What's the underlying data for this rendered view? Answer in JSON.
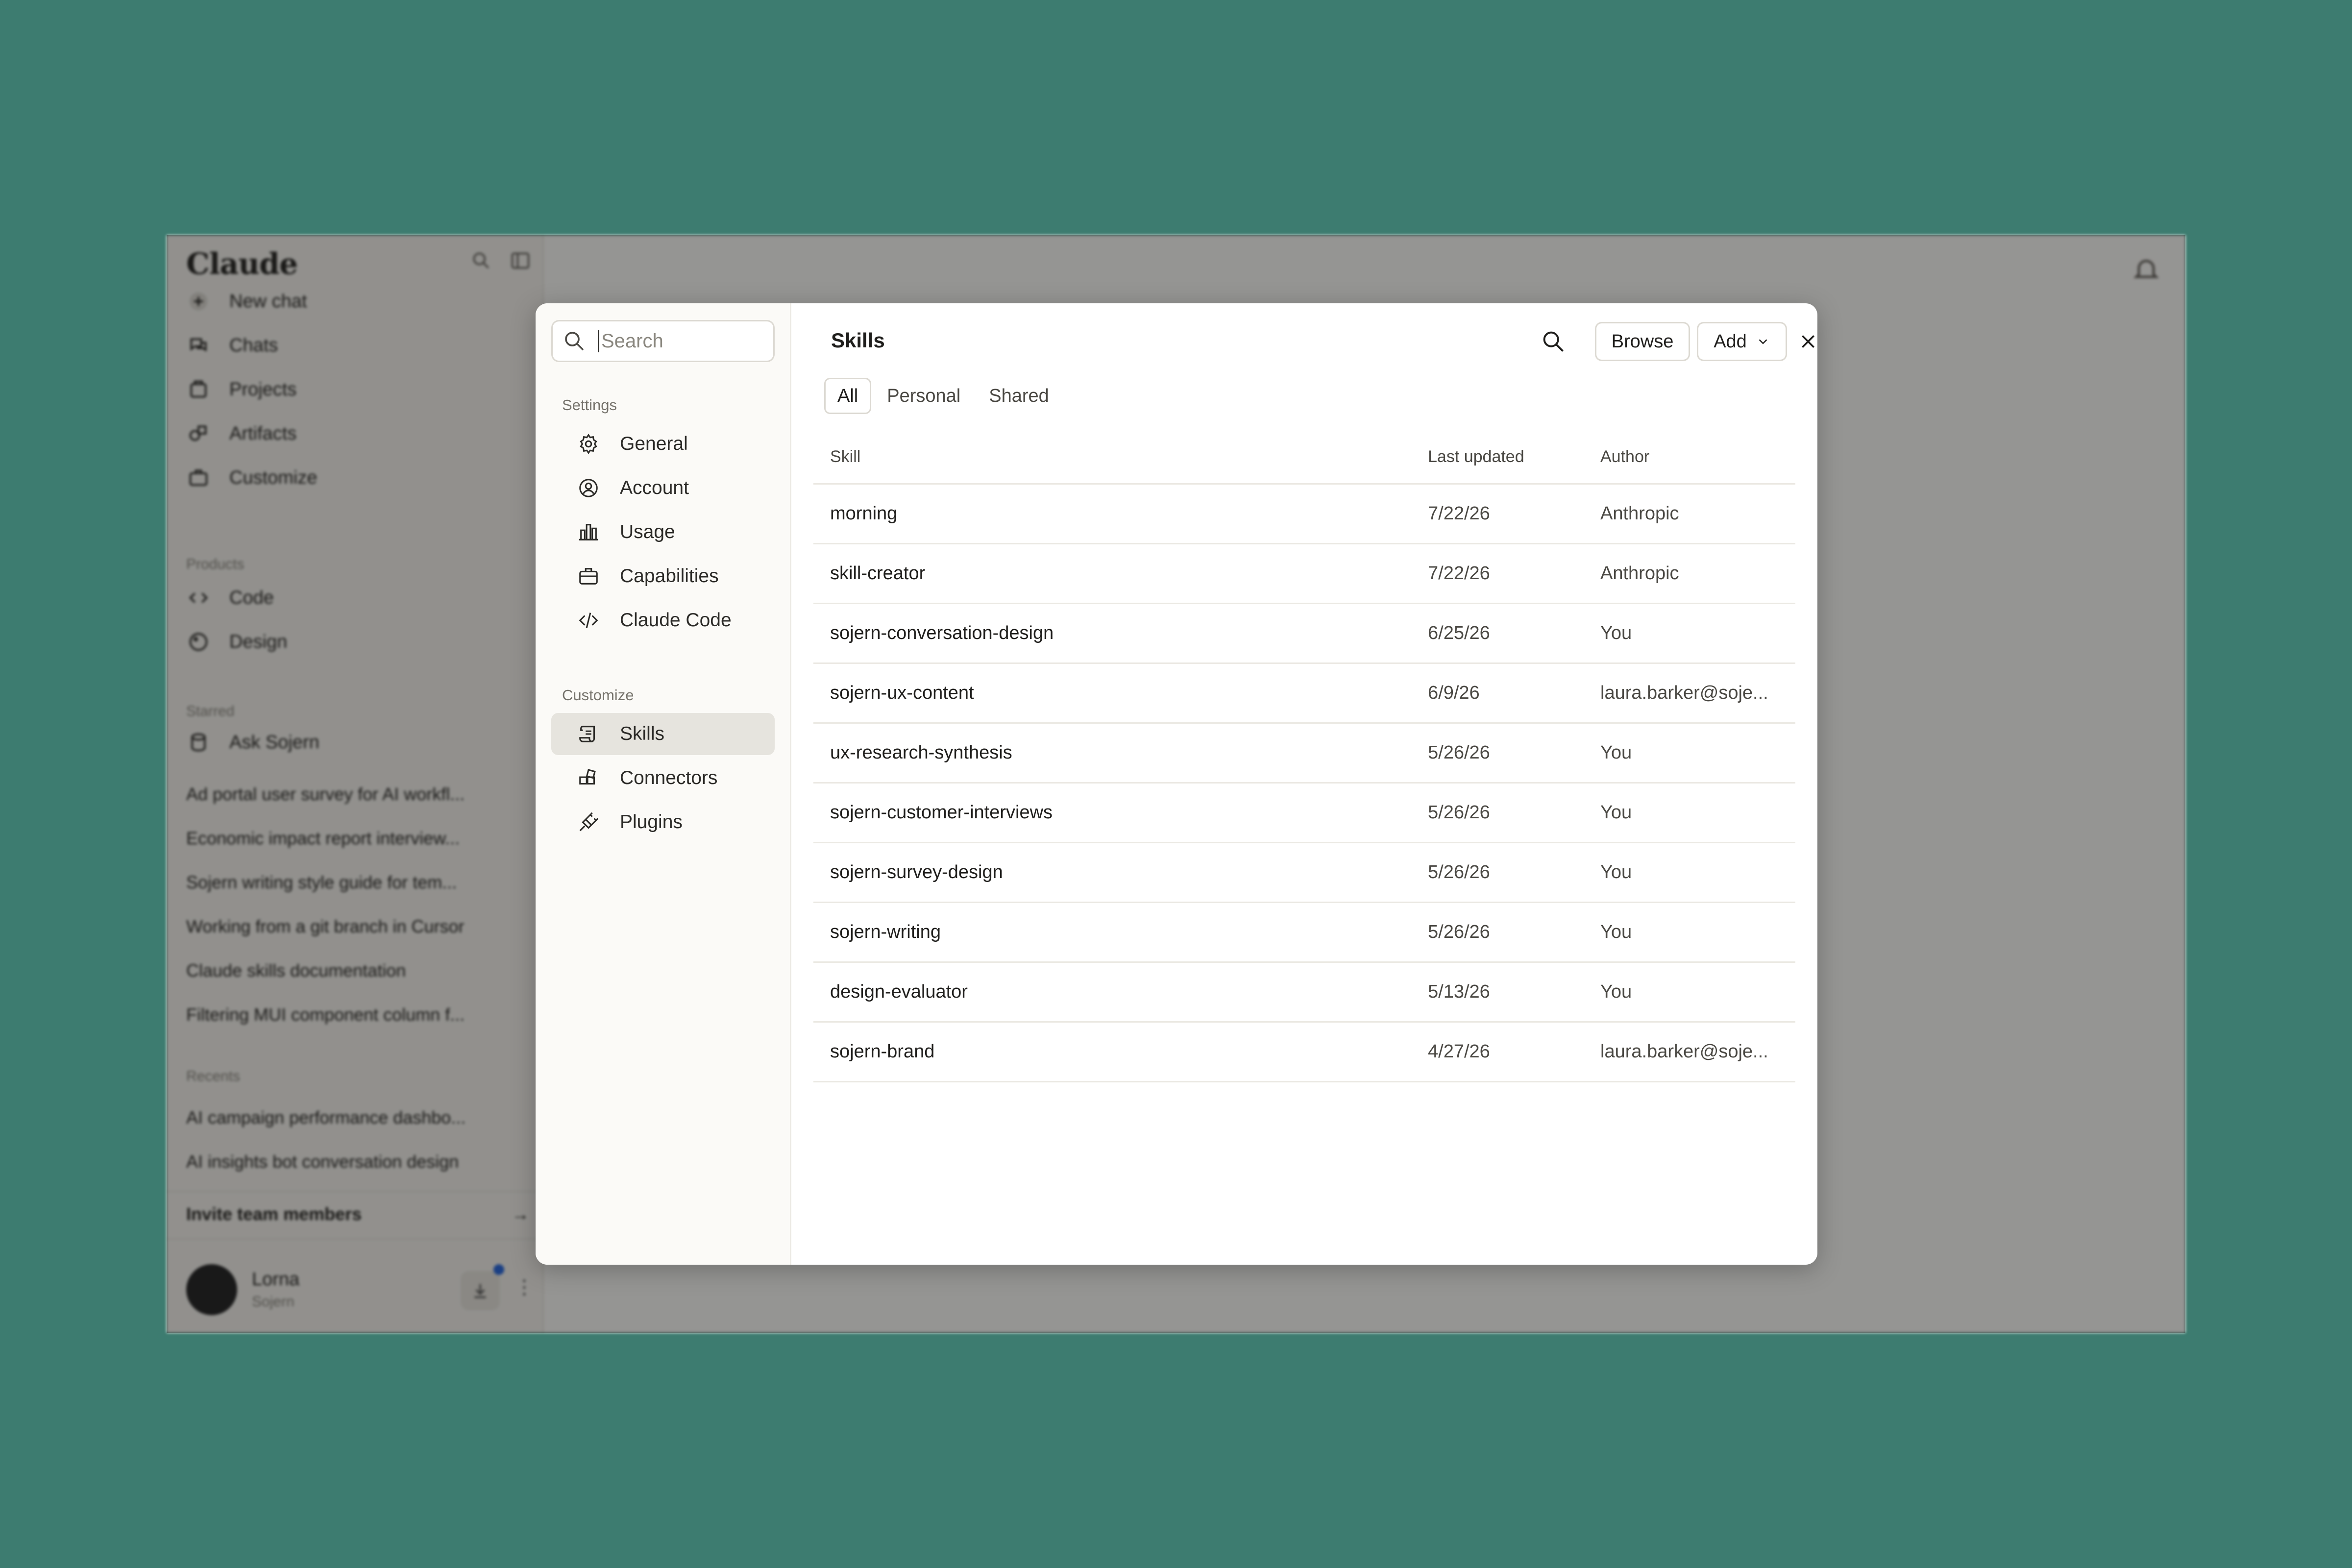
{
  "background_app": {
    "brand": "Claude",
    "nav": [
      "New chat",
      "Chats",
      "Projects",
      "Artifacts",
      "Customize"
    ],
    "products_heading": "Products",
    "products": [
      "Code",
      "Design"
    ],
    "starred_heading": "Starred",
    "starred": [
      "Ask Sojern",
      "Ad portal user survey for AI workfl...",
      "Economic impact report interview...",
      "Sojern writing style guide for tem...",
      "Working from a git branch in Cursor",
      "Claude skills documentation",
      "Filtering MUI component column f..."
    ],
    "recents_heading": "Recents",
    "recents": [
      "AI campaign performance dashbo...",
      "AI insights bot conversation design"
    ],
    "invite_label": "Invite team members",
    "invite_arrow": "→",
    "user": {
      "name": "Lorna",
      "org": "Sojern"
    }
  },
  "modal": {
    "search": {
      "placeholder": "Search",
      "value": ""
    },
    "settings_heading": "Settings",
    "settings_items": [
      {
        "label": "General",
        "icon": "gear-icon"
      },
      {
        "label": "Account",
        "icon": "user-circle-icon"
      },
      {
        "label": "Usage",
        "icon": "bar-chart-icon"
      },
      {
        "label": "Capabilities",
        "icon": "briefcase-icon"
      },
      {
        "label": "Claude Code",
        "icon": "code-icon"
      }
    ],
    "customize_heading": "Customize",
    "customize_items": [
      {
        "label": "Skills",
        "icon": "scroll-icon",
        "active": true
      },
      {
        "label": "Connectors",
        "icon": "connector-icon",
        "active": false
      },
      {
        "label": "Plugins",
        "icon": "plug-icon",
        "active": false
      }
    ],
    "panel": {
      "title": "Skills",
      "browse_label": "Browse",
      "add_label": "Add",
      "tabs": [
        {
          "label": "All",
          "active": true
        },
        {
          "label": "Personal",
          "active": false
        },
        {
          "label": "Shared",
          "active": false
        }
      ],
      "columns": {
        "skill": "Skill",
        "updated": "Last updated",
        "author": "Author"
      },
      "rows": [
        {
          "skill": "morning",
          "updated": "7/22/26",
          "author": "Anthropic"
        },
        {
          "skill": "skill-creator",
          "updated": "7/22/26",
          "author": "Anthropic"
        },
        {
          "skill": "sojern-conversation-design",
          "updated": "6/25/26",
          "author": "You"
        },
        {
          "skill": "sojern-ux-content",
          "updated": "6/9/26",
          "author": "laura.barker@soje..."
        },
        {
          "skill": "ux-research-synthesis",
          "updated": "5/26/26",
          "author": "You"
        },
        {
          "skill": "sojern-customer-interviews",
          "updated": "5/26/26",
          "author": "You"
        },
        {
          "skill": "sojern-survey-design",
          "updated": "5/26/26",
          "author": "You"
        },
        {
          "skill": "sojern-writing",
          "updated": "5/26/26",
          "author": "You"
        },
        {
          "skill": "design-evaluator",
          "updated": "5/13/26",
          "author": "You"
        },
        {
          "skill": "sojern-brand",
          "updated": "4/27/26",
          "author": "laura.barker@soje..."
        }
      ]
    }
  },
  "colors": {
    "page_background": "#3d7c70",
    "active_nav": "#e6e4de",
    "text": "#1f1e1c",
    "muted": "#75726b"
  }
}
